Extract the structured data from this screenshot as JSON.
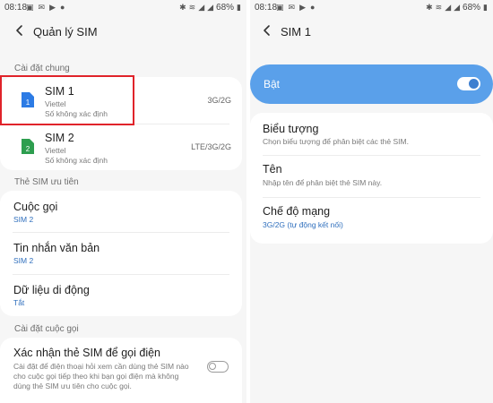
{
  "left_screen": {
    "status_bar": {
      "time": "08:18",
      "battery": "68%"
    },
    "header": {
      "title": "Quản lý SIM"
    },
    "general_section": {
      "heading": "Cài đặt chung",
      "sims": [
        {
          "name": "SIM 1",
          "number": "1",
          "carrier": "Viettel",
          "phone": "Số không xác định",
          "network": "3G/2G",
          "color": "#2c7be5"
        },
        {
          "name": "SIM 2",
          "number": "2",
          "carrier": "Viettel",
          "phone": "Số không xác định",
          "network": "LTE/3G/2G",
          "color": "#2e9e4f"
        }
      ]
    },
    "preferred_section": {
      "heading": "Thẻ SIM ưu tiên",
      "items": [
        {
          "label": "Cuộc gọi",
          "value": "SIM 2"
        },
        {
          "label": "Tin nhắn văn bản",
          "value": "SIM 2"
        },
        {
          "label": "Dữ liệu di động",
          "value": "Tắt"
        }
      ]
    },
    "call_section": {
      "heading": "Cài đặt cuộc gọi",
      "confirm": {
        "label": "Xác nhận thẻ SIM để gọi điện",
        "desc_lines": [
          "Cài đặt để điện thoại hỏi xem cần dùng thẻ SIM nào",
          "cho cuộc gọi tiếp theo khi bạn gọi điện mà không",
          "dùng thẻ SIM ưu tiên cho cuộc gọi."
        ],
        "enabled": false
      }
    }
  },
  "right_screen": {
    "status_bar": {
      "time": "08:18",
      "battery": "68%"
    },
    "header": {
      "title": "SIM 1"
    },
    "master_switch": {
      "label": "Bật",
      "enabled": true
    },
    "items": [
      {
        "label": "Biểu tượng",
        "desc": "Chọn biểu tượng để phân biệt các thẻ SIM."
      },
      {
        "label": "Tên",
        "desc": "Nhập tên để phân biệt thẻ SIM này."
      },
      {
        "label": "Chế độ mạng",
        "value": "3G/2G (tự động kết nối)"
      }
    ]
  },
  "colors": {
    "accent": "#2f6fbd",
    "switch_bar": "#5aa0ea",
    "highlight": "#e0232a"
  }
}
